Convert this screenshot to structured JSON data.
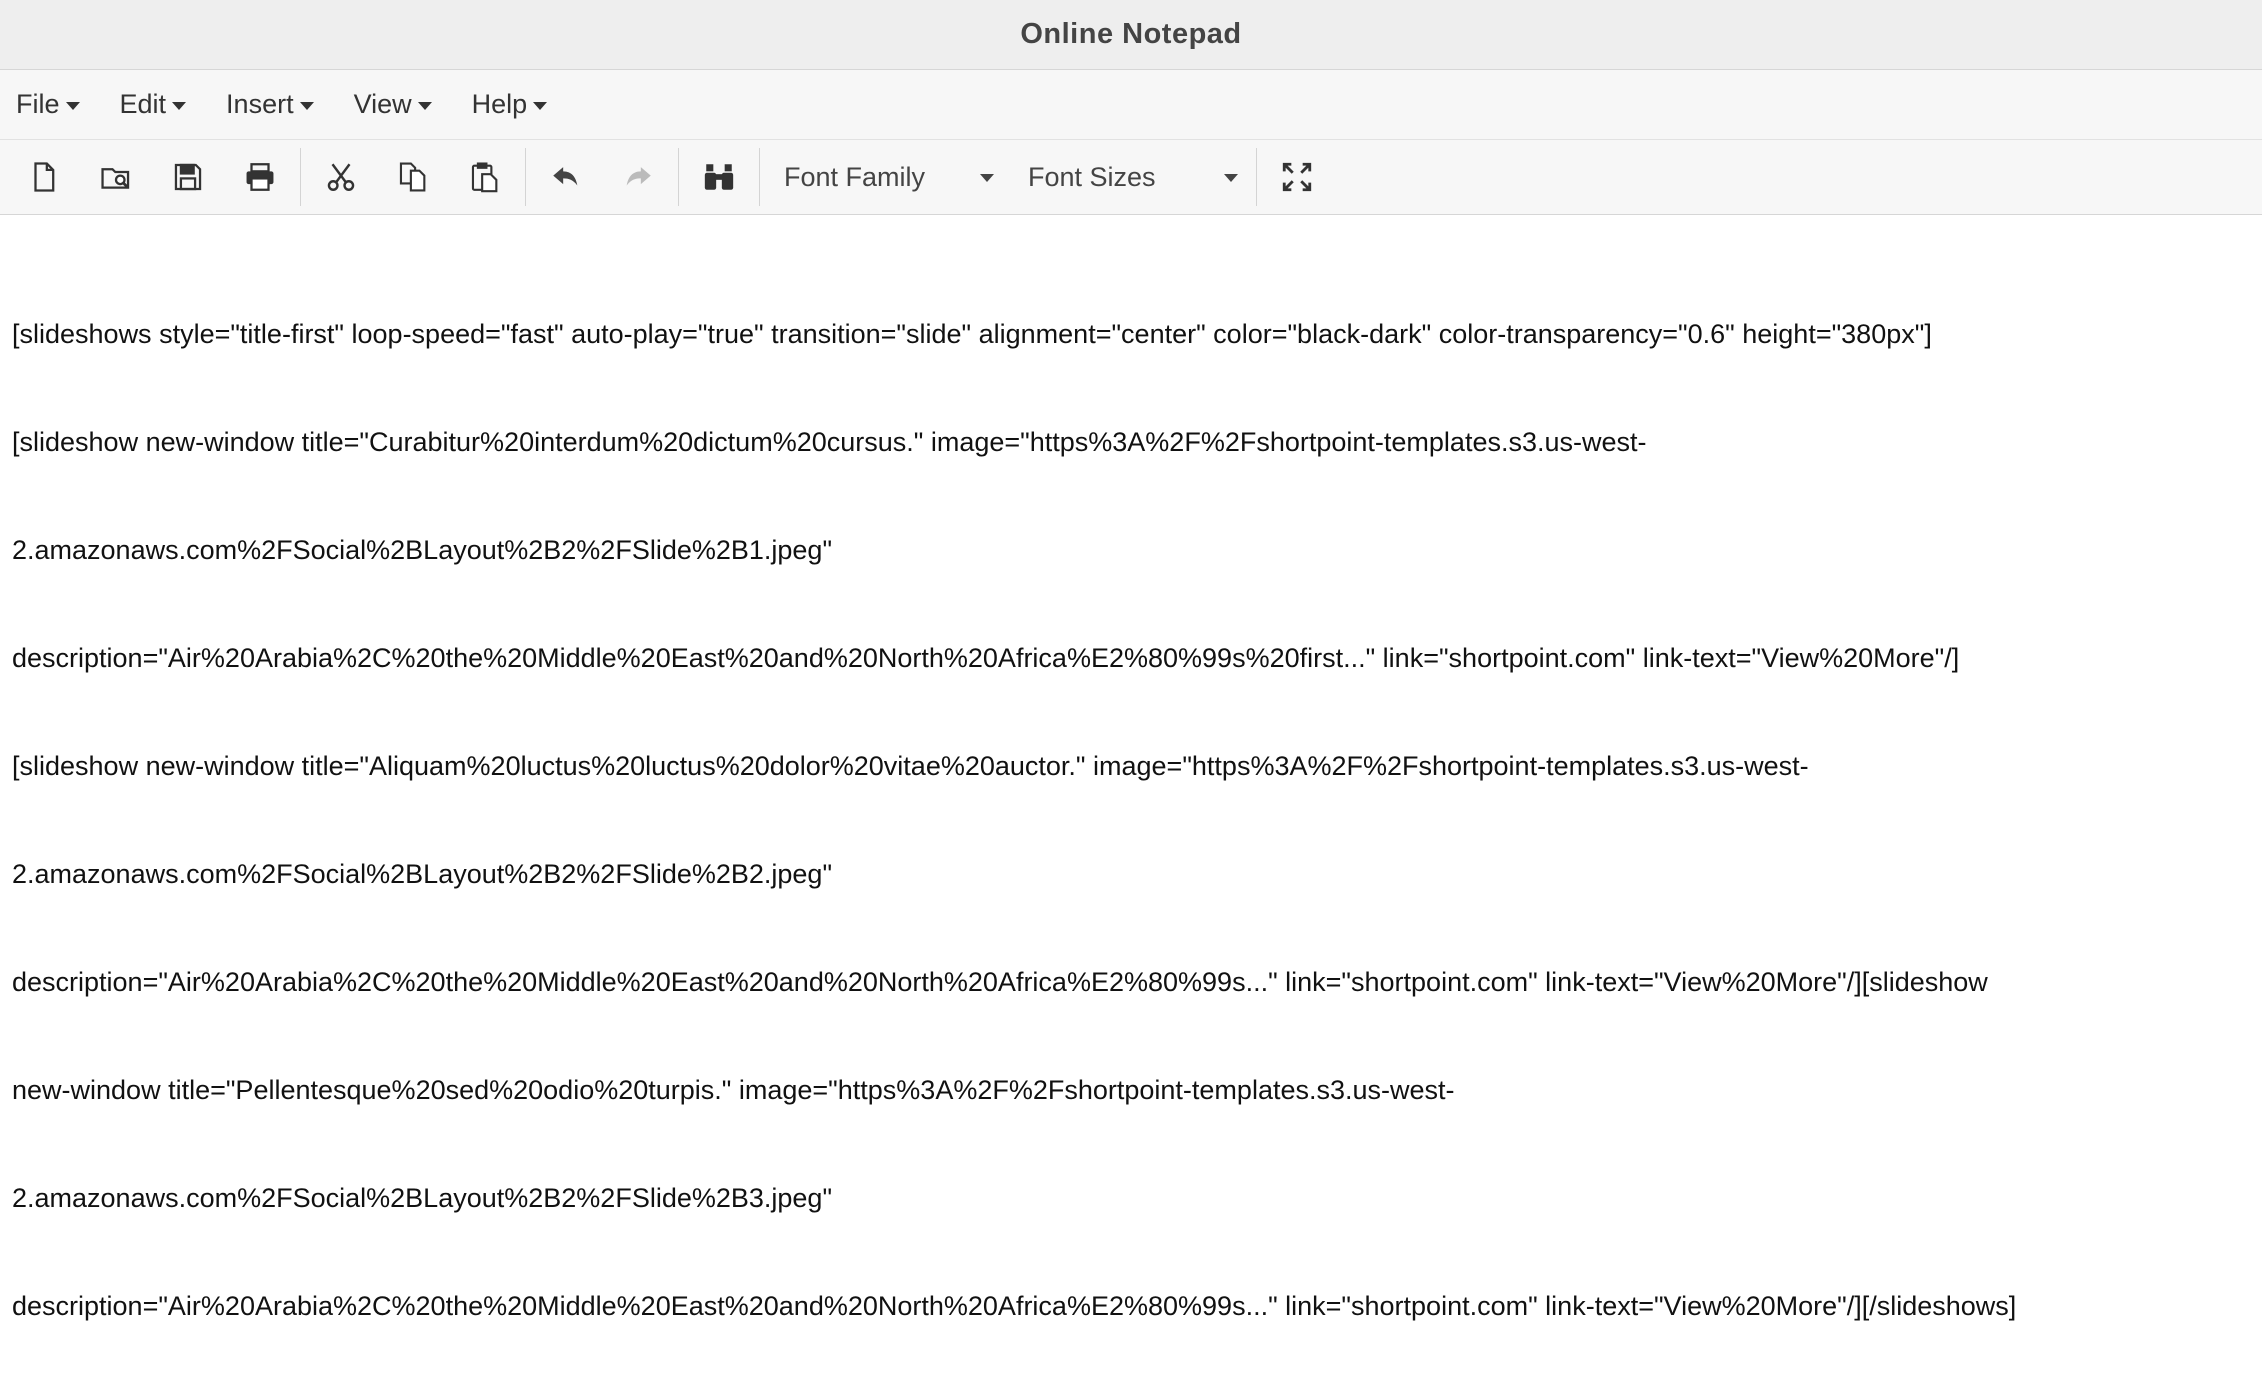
{
  "window": {
    "title": "Online Notepad"
  },
  "menu": [
    {
      "label": "File"
    },
    {
      "label": "Edit"
    },
    {
      "label": "Insert"
    },
    {
      "label": "View"
    },
    {
      "label": "Help"
    }
  ],
  "toolbar": {
    "font_family_label": "Font Family",
    "font_sizes_label": "Font Sizes",
    "buttons": [
      {
        "icon": "new-file-icon"
      },
      {
        "icon": "open-file-icon"
      },
      {
        "icon": "save-icon"
      },
      {
        "icon": "print-icon"
      },
      {
        "icon": "cut-icon"
      },
      {
        "icon": "copy-icon"
      },
      {
        "icon": "paste-icon"
      },
      {
        "icon": "undo-icon"
      },
      {
        "icon": "redo-icon"
      },
      {
        "icon": "find-icon"
      },
      {
        "icon": "fullscreen-icon"
      }
    ]
  },
  "editor": {
    "lines": [
      "[slideshows style=\"title-first\" loop-speed=\"fast\" auto-play=\"true\" transition=\"slide\" alignment=\"center\" color=\"black-dark\" color-transparency=\"0.6\" height=\"380px\"]",
      "[slideshow new-window title=\"Curabitur%20interdum%20dictum%20cursus.\" image=\"https%3A%2F%2Fshortpoint-templates.s3.us-west-",
      "2.amazonaws.com%2FSocial%2BLayout%2B2%2FSlide%2B1.jpeg\"",
      "description=\"Air%20Arabia%2C%20the%20Middle%20East%20and%20North%20Africa%E2%80%99s%20first...\" link=\"shortpoint.com\" link-text=\"View%20More\"/]",
      "[slideshow new-window title=\"Aliquam%20luctus%20luctus%20dolor%20vitae%20auctor.\" image=\"https%3A%2F%2Fshortpoint-templates.s3.us-west-",
      "2.amazonaws.com%2FSocial%2BLayout%2B2%2FSlide%2B2.jpeg\"",
      "description=\"Air%20Arabia%2C%20the%20Middle%20East%20and%20North%20Africa%E2%80%99s...\" link=\"shortpoint.com\" link-text=\"View%20More\"/][slideshow",
      "new-window title=\"Pellentesque%20sed%20odio%20turpis.\" image=\"https%3A%2F%2Fshortpoint-templates.s3.us-west-",
      "2.amazonaws.com%2FSocial%2BLayout%2B2%2FSlide%2B3.jpeg\"",
      "description=\"Air%20Arabia%2C%20the%20Middle%20East%20and%20North%20Africa%E2%80%99s...\" link=\"shortpoint.com\" link-text=\"View%20More\"/][/slideshows]"
    ]
  }
}
